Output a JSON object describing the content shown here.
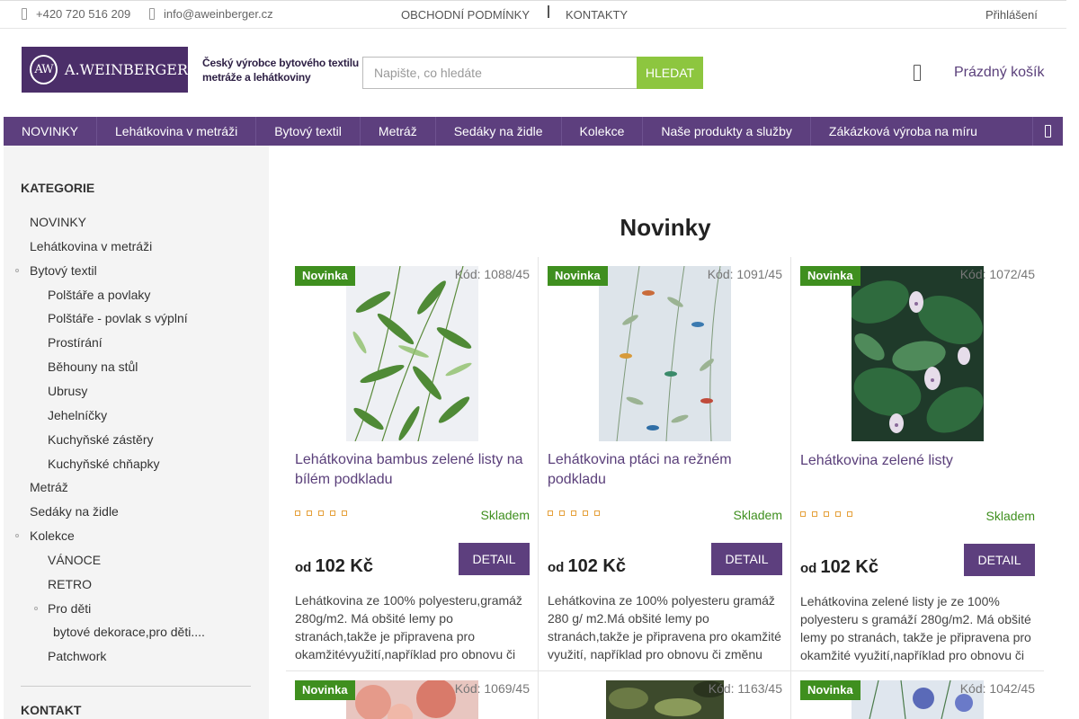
{
  "topbar": {
    "phone": "+420 720 516 209",
    "email": "info@aweinberger.cz",
    "links": [
      "OBCHODNÍ PODMÍNKY",
      "KONTAKTY"
    ],
    "login": "Přihlášení"
  },
  "header": {
    "logo_mark": "AW",
    "logo_word": "A.WEINBERGER",
    "tagline_1": "Český výrobce bytového textilu",
    "tagline_2": "metráže a lehátkoviny",
    "search_placeholder": "Napište, co hledáte",
    "search_button": "HLEDAT",
    "cart": "Prázdný košík"
  },
  "nav": [
    "NOVINKY",
    "Lehátkovina v metráži",
    "Bytový textil",
    "Metráž",
    "Sedáky na židle",
    "Kolekce",
    "Naše produkty a služby",
    "Zákázková výroba na míru"
  ],
  "sidebar": {
    "heading": "KATEGORIE",
    "items": [
      {
        "label": "NOVINKY",
        "level": 0,
        "bullet": false
      },
      {
        "label": "Lehátkovina v metráži",
        "level": 0,
        "bullet": false
      },
      {
        "label": "Bytový textil",
        "level": 0,
        "bullet": true
      },
      {
        "label": "Polštáře a povlaky",
        "level": 1,
        "bullet": false
      },
      {
        "label": "Polštáře - povlak s výplní",
        "level": 1,
        "bullet": false
      },
      {
        "label": "Prostírání",
        "level": 1,
        "bullet": false
      },
      {
        "label": "Běhouny na stůl",
        "level": 1,
        "bullet": false
      },
      {
        "label": "Ubrusy",
        "level": 1,
        "bullet": false
      },
      {
        "label": "Jehelníčky",
        "level": 1,
        "bullet": false
      },
      {
        "label": "Kuchyňské zástěry",
        "level": 1,
        "bullet": false
      },
      {
        "label": "Kuchyňské chňapky",
        "level": 1,
        "bullet": false
      },
      {
        "label": "Metráž",
        "level": 0,
        "bullet": false
      },
      {
        "label": "Sedáky na židle",
        "level": 0,
        "bullet": false
      },
      {
        "label": "Kolekce",
        "level": 0,
        "bullet": true
      },
      {
        "label": "VÁNOCE",
        "level": 1,
        "bullet": false
      },
      {
        "label": "RETRO",
        "level": 1,
        "bullet": false
      },
      {
        "label": "Pro děti",
        "level": 1,
        "bullet": true
      },
      {
        "label": "bytové dekorace,pro děti....",
        "level": 2,
        "bullet": false
      },
      {
        "label": "Patchwork",
        "level": 1,
        "bullet": false
      }
    ],
    "contact_heading": "KONTAKT"
  },
  "main": {
    "title": "Novinky",
    "products": [
      {
        "badge": "Novinka",
        "code": "Kód: 1088/45",
        "title": "Lehátkovina bambus zelené listy na bílém podkladu",
        "stock": "Skladem",
        "price_prefix": "od",
        "price": "102 Kč",
        "button": "DETAIL",
        "description": "Lehátkovina ze 100% polyesteru,gramáž 280g/m2. Má obšité lemy po stranách,takže je připravena pro okamžitévyužití,například pro obnovu či"
      },
      {
        "badge": "Novinka",
        "code": "Kód: 1091/45",
        "title": "Lehátkovina ptáci na režném podkladu",
        "stock": "Skladem",
        "price_prefix": "od",
        "price": "102 Kč",
        "button": "DETAIL",
        "description": "Lehátkovina ze 100% polyesteru gramáž 280 g/ m2.Má obšité lemy po stranách,takže je připravena pro okamžité využití, například pro obnovu či změnu"
      },
      {
        "badge": "Novinka",
        "code": "Kód: 1072/45",
        "title": "Lehátkovina zelené listy",
        "stock": "Skladem",
        "price_prefix": "od",
        "price": "102 Kč",
        "button": "DETAIL",
        "description": "Lehátkovina zelené listy  je ze 100% polyesteru s gramáží 280g/m2. Má obšité lemy po stranách, takže je  připravena pro okamžité využití,například pro obnovu či"
      }
    ],
    "row2": [
      {
        "badge": "Novinka",
        "code": "Kód: 1069/45"
      },
      {
        "badge": "",
        "code": "Kód: 1163/45"
      },
      {
        "badge": "Novinka",
        "code": "Kód: 1042/45"
      }
    ]
  }
}
